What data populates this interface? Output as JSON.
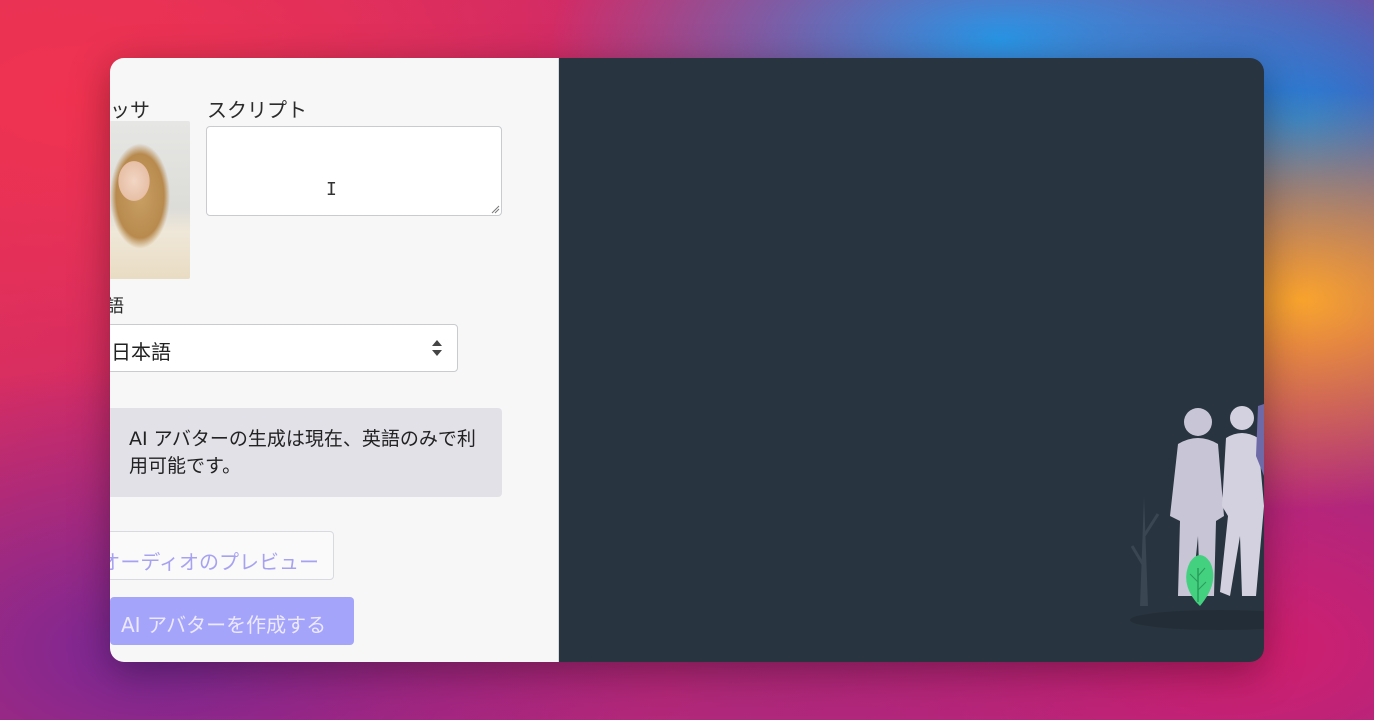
{
  "form": {
    "avatar_label_partial": "ッサ",
    "script_label": "スクリプト",
    "script_value": "",
    "language_label_partial": "語",
    "language_selected": "日本語",
    "notice": "AI アバターの生成は現在、英語のみで利用可能です。",
    "preview_button": "オーディオのプレビュー",
    "create_button": "AI アバターを作成する"
  },
  "colors": {
    "accent": "#a5a4fb",
    "preview_text": "#a7a2f0",
    "right_panel_bg": "#28343f",
    "notice_bg": "#e3e1e8"
  },
  "icons": [
    "select-arrows-icon",
    "text-cursor-icon",
    "resize-grip-icon",
    "people-illustration"
  ]
}
